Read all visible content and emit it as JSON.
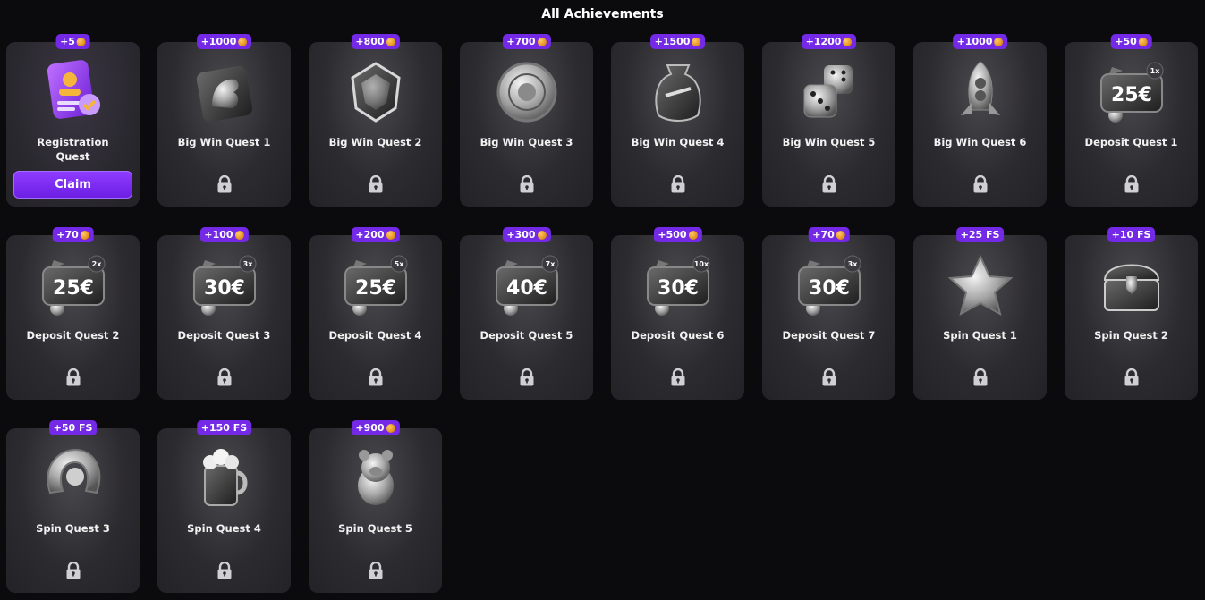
{
  "page": {
    "title": "All Achievements"
  },
  "colors": {
    "accent": "#7329e6",
    "background": "#0b0a0d",
    "card": "#2c2b30",
    "coin": "#e08a14"
  },
  "achievements": [
    {
      "name": "Registration Quest",
      "reward": "+5",
      "reward_type": "coin",
      "icon": "registration-card-icon",
      "claimable": true,
      "claim_label": "Claim"
    },
    {
      "name": "Big Win Quest 1",
      "reward": "+1000",
      "reward_type": "coin",
      "icon": "horse-head-icon",
      "claimable": false
    },
    {
      "name": "Big Win Quest 2",
      "reward": "+800",
      "reward_type": "coin",
      "icon": "gem-icon",
      "claimable": false
    },
    {
      "name": "Big Win Quest 3",
      "reward": "+700",
      "reward_type": "coin",
      "icon": "medallion-icon",
      "claimable": false
    },
    {
      "name": "Big Win Quest 4",
      "reward": "+1500",
      "reward_type": "coin",
      "icon": "money-bag-icon",
      "claimable": false
    },
    {
      "name": "Big Win Quest 5",
      "reward": "+1200",
      "reward_type": "coin",
      "icon": "dice-icon",
      "claimable": false
    },
    {
      "name": "Big Win Quest 6",
      "reward": "+1000",
      "reward_type": "coin",
      "icon": "rocket-icon",
      "claimable": false
    },
    {
      "name": "Deposit Quest 1",
      "reward": "+50",
      "reward_type": "coin",
      "icon": "deposit-voucher-icon",
      "amount": "25€",
      "multiplier": "1x",
      "claimable": false
    },
    {
      "name": "Deposit Quest 2",
      "reward": "+70",
      "reward_type": "coin",
      "icon": "deposit-voucher-icon",
      "amount": "25€",
      "multiplier": "2x",
      "claimable": false
    },
    {
      "name": "Deposit Quest 3",
      "reward": "+100",
      "reward_type": "coin",
      "icon": "deposit-voucher-icon",
      "amount": "30€",
      "multiplier": "3x",
      "claimable": false
    },
    {
      "name": "Deposit Quest 4",
      "reward": "+200",
      "reward_type": "coin",
      "icon": "deposit-voucher-icon",
      "amount": "25€",
      "multiplier": "5x",
      "claimable": false
    },
    {
      "name": "Deposit Quest 5",
      "reward": "+300",
      "reward_type": "coin",
      "icon": "deposit-voucher-icon",
      "amount": "40€",
      "multiplier": "7x",
      "claimable": false
    },
    {
      "name": "Deposit Quest 6",
      "reward": "+500",
      "reward_type": "coin",
      "icon": "deposit-voucher-icon",
      "amount": "30€",
      "multiplier": "10x",
      "claimable": false
    },
    {
      "name": "Deposit Quest 7",
      "reward": "+70",
      "reward_type": "coin",
      "icon": "deposit-voucher-icon",
      "amount": "30€",
      "multiplier": "3x",
      "claimable": false
    },
    {
      "name": "Spin Quest 1",
      "reward": "+25 FS",
      "reward_type": "fs",
      "icon": "star-icon",
      "claimable": false
    },
    {
      "name": "Spin Quest 2",
      "reward": "+10 FS",
      "reward_type": "fs",
      "icon": "treasure-chest-icon",
      "claimable": false
    },
    {
      "name": "Spin Quest 3",
      "reward": "+50 FS",
      "reward_type": "fs",
      "icon": "horseshoe-icon",
      "claimable": false
    },
    {
      "name": "Spin Quest 4",
      "reward": "+150 FS",
      "reward_type": "fs",
      "icon": "beer-mug-icon",
      "claimable": false
    },
    {
      "name": "Spin Quest 5",
      "reward": "+900",
      "reward_type": "coin",
      "icon": "pig-icon",
      "claimable": false
    }
  ]
}
